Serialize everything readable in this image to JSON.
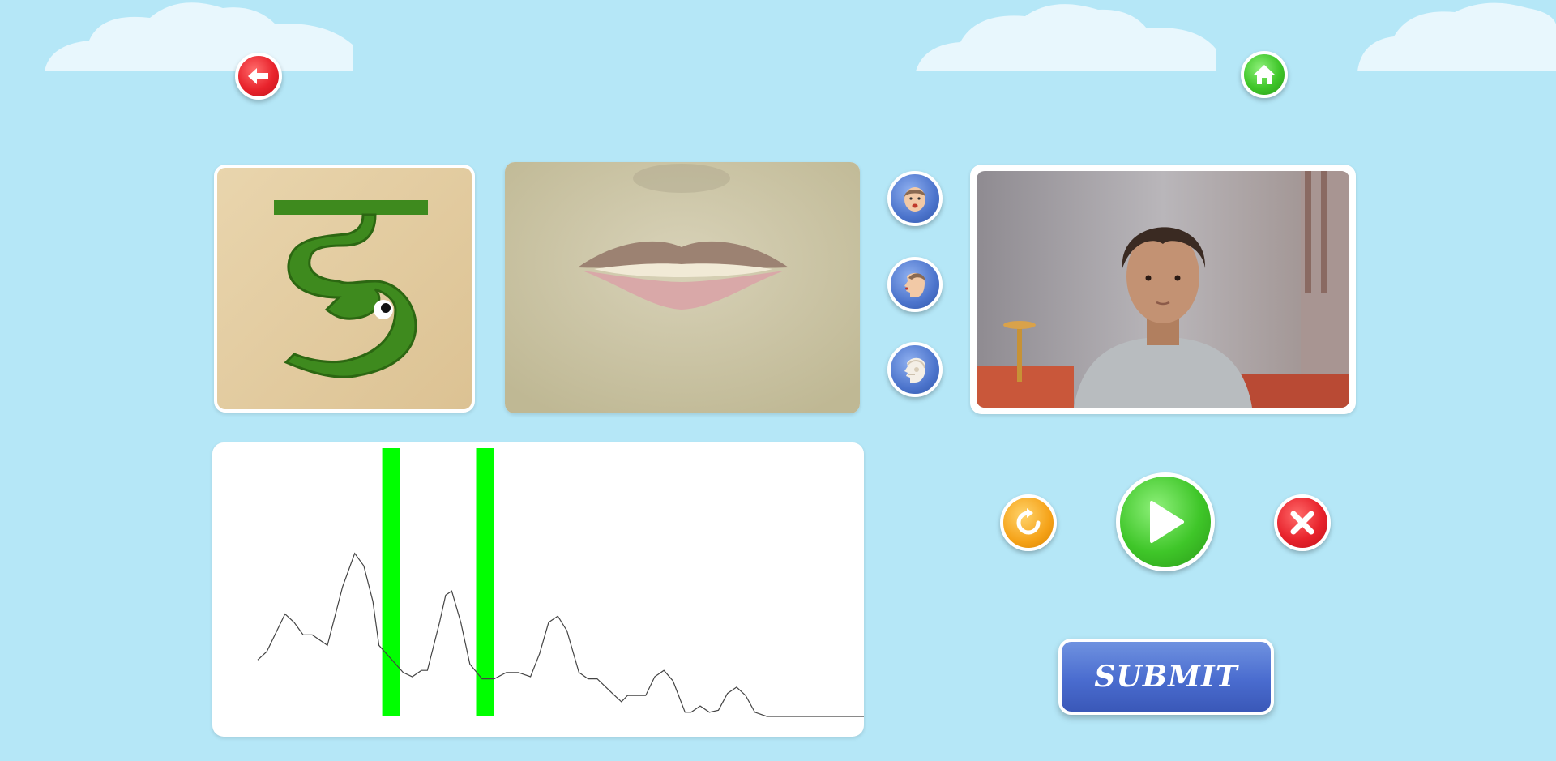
{
  "nav": {
    "back_icon": "arrow-left-icon",
    "home_icon": "home-icon"
  },
  "letter_card": {
    "glyph": "इ",
    "colors": {
      "glyph": "#3e8a1e",
      "background": "#e6cfa4"
    }
  },
  "view_buttons": [
    {
      "name": "front-face-view",
      "icon": "face-front-icon"
    },
    {
      "name": "side-face-view",
      "icon": "face-side-icon"
    },
    {
      "name": "skull-view",
      "icon": "skull-side-icon"
    }
  ],
  "waveform": {
    "points": [
      [
        0,
        0.27
      ],
      [
        0.015,
        0.31
      ],
      [
        0.045,
        0.49
      ],
      [
        0.06,
        0.45
      ],
      [
        0.075,
        0.39
      ],
      [
        0.09,
        0.39
      ],
      [
        0.115,
        0.34
      ],
      [
        0.14,
        0.62
      ],
      [
        0.16,
        0.78
      ],
      [
        0.175,
        0.72
      ],
      [
        0.19,
        0.55
      ],
      [
        0.2,
        0.34
      ],
      [
        0.24,
        0.21
      ],
      [
        0.255,
        0.19
      ],
      [
        0.27,
        0.22
      ],
      [
        0.28,
        0.22
      ],
      [
        0.3,
        0.45
      ],
      [
        0.31,
        0.58
      ],
      [
        0.32,
        0.6
      ],
      [
        0.335,
        0.45
      ],
      [
        0.35,
        0.25
      ],
      [
        0.37,
        0.18
      ],
      [
        0.39,
        0.18
      ],
      [
        0.41,
        0.21
      ],
      [
        0.43,
        0.21
      ],
      [
        0.45,
        0.19
      ],
      [
        0.465,
        0.3
      ],
      [
        0.48,
        0.45
      ],
      [
        0.495,
        0.48
      ],
      [
        0.51,
        0.41
      ],
      [
        0.53,
        0.21
      ],
      [
        0.545,
        0.18
      ],
      [
        0.56,
        0.18
      ],
      [
        0.585,
        0.11
      ],
      [
        0.6,
        0.07
      ],
      [
        0.61,
        0.1
      ],
      [
        0.625,
        0.1
      ],
      [
        0.64,
        0.1
      ],
      [
        0.655,
        0.19
      ],
      [
        0.67,
        0.22
      ],
      [
        0.685,
        0.17
      ],
      [
        0.705,
        0.02
      ],
      [
        0.715,
        0.02
      ],
      [
        0.73,
        0.05
      ],
      [
        0.745,
        0.02
      ],
      [
        0.76,
        0.03
      ],
      [
        0.775,
        0.11
      ],
      [
        0.79,
        0.14
      ],
      [
        0.805,
        0.1
      ],
      [
        0.82,
        0.02
      ],
      [
        0.84,
        0
      ],
      [
        0.87,
        0
      ],
      [
        1,
        0
      ]
    ],
    "markers": [
      0.22,
      0.375
    ],
    "marker_color": "#00ff00"
  },
  "controls": {
    "reload_icon": "reload-icon",
    "play_icon": "play-icon",
    "close_icon": "close-icon"
  },
  "submit": {
    "label": "SUBMIT"
  }
}
